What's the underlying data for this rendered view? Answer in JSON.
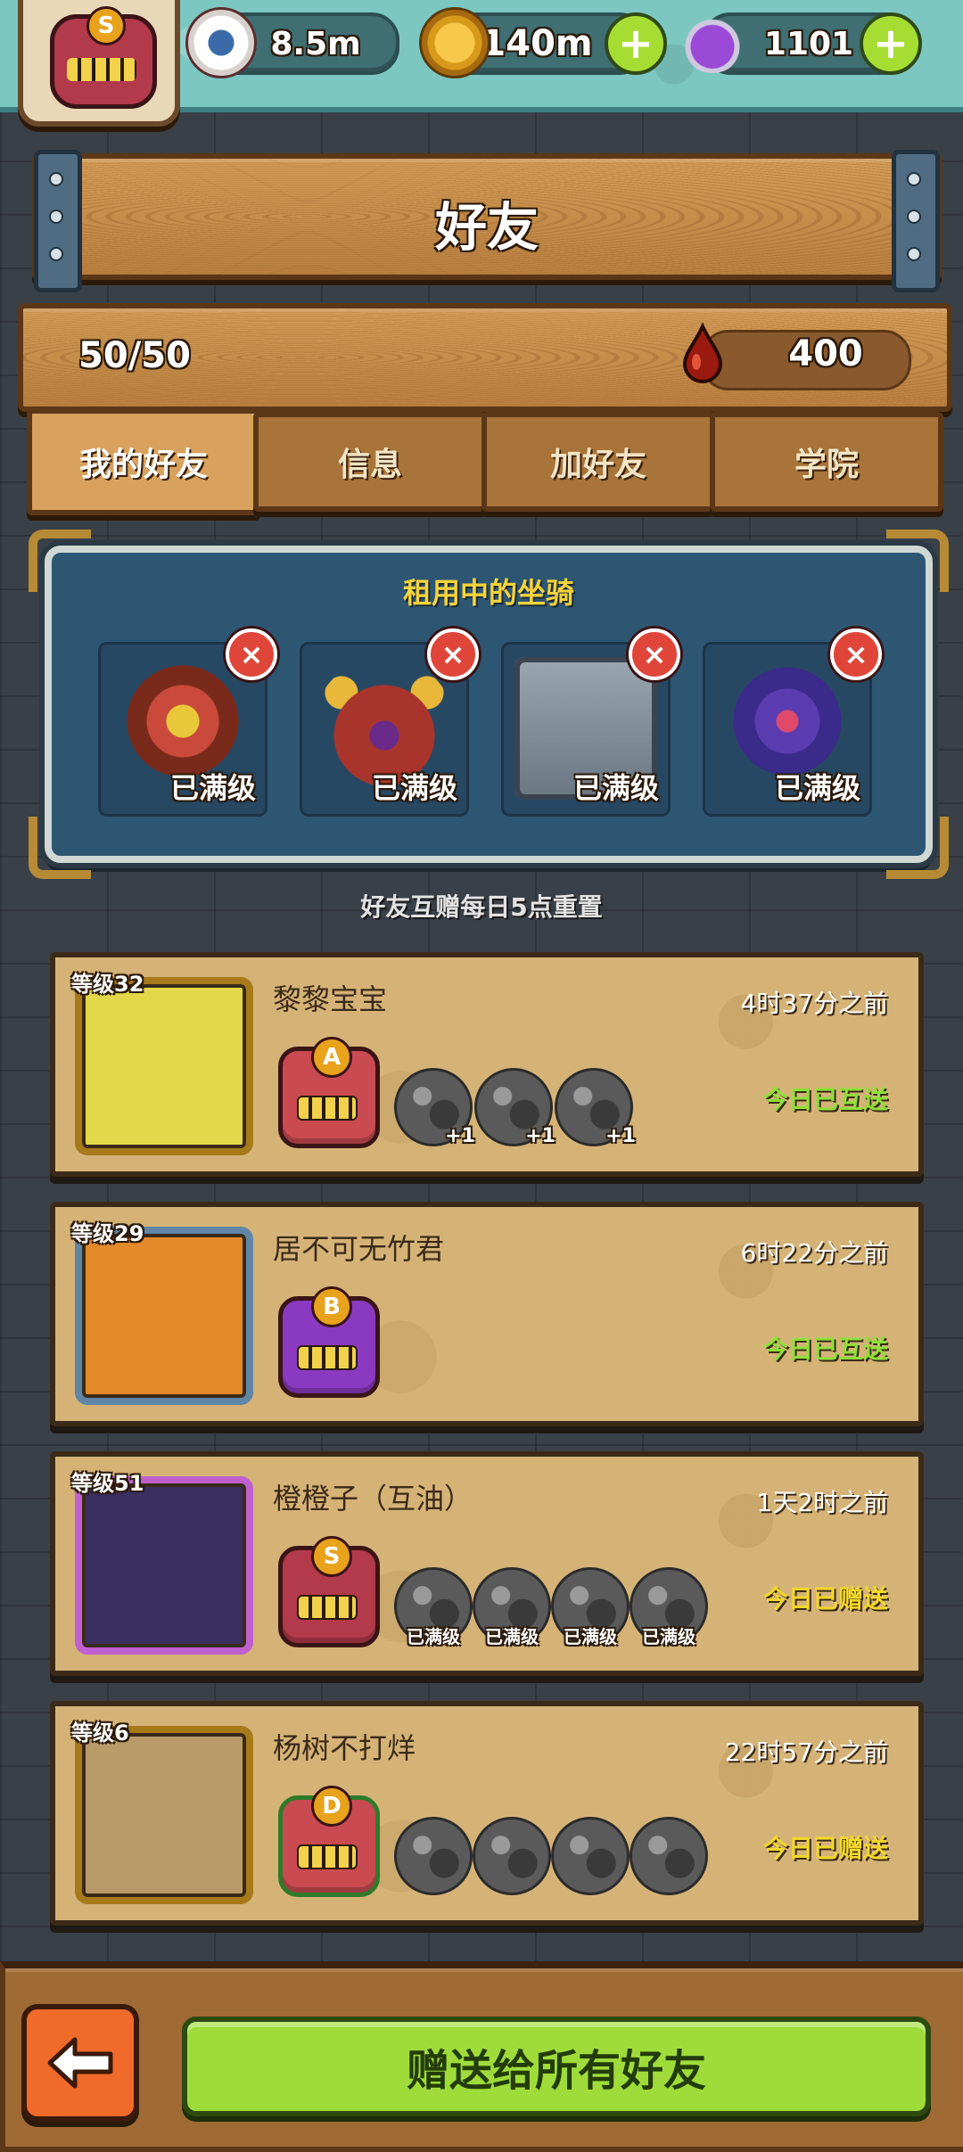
{
  "topbar": {
    "eyes_value": "8.5m",
    "coins_value": "140m",
    "potion_value": "1101",
    "add_label": "+",
    "avatar_rank": "S"
  },
  "header": {
    "title": "好友"
  },
  "stats": {
    "friend_count": "50/50",
    "blood_value": "400"
  },
  "tabs": [
    {
      "label": "我的好友",
      "active": true
    },
    {
      "label": "信息"
    },
    {
      "label": "加好友"
    },
    {
      "label": "学院"
    }
  ],
  "mounts_panel": {
    "title": "租用中的坐骑",
    "items": [
      {
        "label": "已满级",
        "color": "#c94a3a"
      },
      {
        "label": "已满级",
        "color": "#a8342c"
      },
      {
        "label": "已满级",
        "color": "#7b8894"
      },
      {
        "label": "已满级",
        "color": "#5a3bb0"
      }
    ],
    "remove_symbol": "×"
  },
  "reset_note": "好友互赠每日5点重置",
  "friends": [
    {
      "level": "等级32",
      "name": "黎黎宝宝",
      "time": "4时37分之前",
      "status": "今日已互送",
      "rank": "A",
      "rank_color": "#c94a50",
      "portrait_color": "#e3d84a",
      "frame_color": "#a77a1a",
      "mounts": [
        {
          "tag": "+1"
        },
        {
          "tag": "+1"
        },
        {
          "tag": "+1"
        }
      ]
    },
    {
      "level": "等级29",
      "name": "居不可无竹君",
      "time": "6时22分之前",
      "status": "今日已互送",
      "rank": "B",
      "rank_color": "#c94a50",
      "portrait_color": "#e38a2a",
      "frame_color": "#5f86a6",
      "mounts": []
    },
    {
      "level": "等级51",
      "name": "橙橙子（互油）",
      "time": "1天2时之前",
      "status": "今日已赠送",
      "rank": "S",
      "rank_color": "#b23a4a",
      "portrait_color": "#3a2f60",
      "frame_color": "#a77a1a",
      "mounts": [
        {
          "tag": "已满级"
        },
        {
          "tag": "已满级"
        },
        {
          "tag": "已满级"
        },
        {
          "tag": "已满级"
        }
      ]
    },
    {
      "level": "等级6",
      "name": "杨树不打烊",
      "time": "22时57分之前",
      "status": "今日已赠送",
      "rank": "D",
      "rank_color": "#c94a50",
      "portrait_color": "#b99b6a",
      "frame_color": "#a77a1a",
      "mounts": [
        {
          "tag": ""
        },
        {
          "tag": ""
        },
        {
          "tag": ""
        },
        {
          "tag": ""
        }
      ]
    }
  ],
  "colors": {
    "status_mutual": "#8ee03a",
    "status_sent": "#f2d82a",
    "accent_green": "#9fdc3a"
  },
  "bottom": {
    "gift_all_label": "赠送给所有好友",
    "back_icon": "arrow-left-icon"
  }
}
